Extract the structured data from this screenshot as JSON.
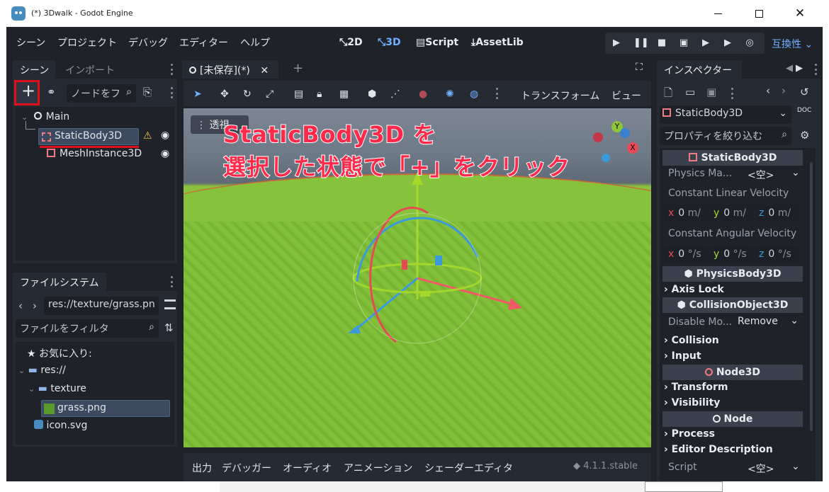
{
  "window": {
    "title": "(*) 3Dwalk - Godot Engine"
  },
  "menu": {
    "items": [
      "シーン",
      "プロジェクト",
      "デバッグ",
      "エディター",
      "ヘルプ"
    ],
    "modes": [
      "2D",
      "3D",
      "Script",
      "AssetLib"
    ],
    "active_mode": "3D",
    "renderer": "互換性"
  },
  "scene_dock": {
    "tabs": [
      "シーン",
      "インポート"
    ],
    "filter_placeholder": "ノードをフ",
    "tree": [
      {
        "label": "Main",
        "icon": "node3d-icon"
      },
      {
        "label": "StaticBody3D",
        "icon": "staticbody3d-icon",
        "selected": true,
        "warning": true
      },
      {
        "label": "MeshInstance3D",
        "icon": "meshinstance3d-icon"
      }
    ]
  },
  "filesystem_dock": {
    "title": "ファイルシステム",
    "path": "res://texture/grass.pn",
    "filter_placeholder": "ファイルをフィルタ",
    "tree": [
      {
        "label": "お気に入り:",
        "icon": "star-icon"
      },
      {
        "label": "res://",
        "icon": "folder-icon"
      },
      {
        "label": "texture",
        "icon": "folder-icon"
      },
      {
        "label": "grass.png",
        "icon": "image-icon",
        "selected": true
      },
      {
        "label": "icon.svg",
        "icon": "godot-icon"
      }
    ]
  },
  "editor": {
    "scene_tab": "[未保存](*)",
    "toolbar": {
      "transform_menu": "トランスフォーム",
      "view_menu": "ビュー"
    },
    "viewport": {
      "perspective_label": "透視",
      "gizmo_axes": [
        "Y",
        "X"
      ]
    },
    "annotation": {
      "line1": "StaticBody3D を",
      "line2": "選択した状態で「+」をクリック"
    }
  },
  "bottom_panel": {
    "tabs": [
      "出力",
      "デバッガー",
      "オーディオ",
      "アニメーション",
      "シェーダーエディタ"
    ],
    "version": "4.1.1.stable"
  },
  "inspector": {
    "tab": "インスペクター",
    "object_name": "StaticBody3D",
    "filter_placeholder": "プロパティを絞り込む",
    "sections": {
      "staticbody": "StaticBody3D",
      "physicsbody": "PhysicsBody3D",
      "collisionobject": "CollisionObject3D",
      "node3d": "Node3D",
      "node": "Node"
    },
    "physics_material": {
      "label": "Physics Ma...",
      "value": "<空>"
    },
    "constant_linear_velocity": {
      "label": "Constant Linear Velocity",
      "x": "0",
      "y": "0",
      "z": "0",
      "unit": "m/"
    },
    "constant_angular_velocity": {
      "label": "Constant Angular Velocity",
      "x": "0",
      "y": "0",
      "z": "0",
      "unit": "°/s"
    },
    "axis_lock": "Axis Lock",
    "disable_mode": {
      "label": "Disable Mo...",
      "value": "Remove"
    },
    "collision": "Collision",
    "input": "Input",
    "transform": "Transform",
    "visibility": "Visibility",
    "process": "Process",
    "editor_description": "Editor Description",
    "script": {
      "label": "Script",
      "value": "<空>"
    }
  },
  "colors": {
    "accent": "#6fb0ff",
    "annotation": "#ff2a4a",
    "highlight_box": "#e0101a"
  }
}
